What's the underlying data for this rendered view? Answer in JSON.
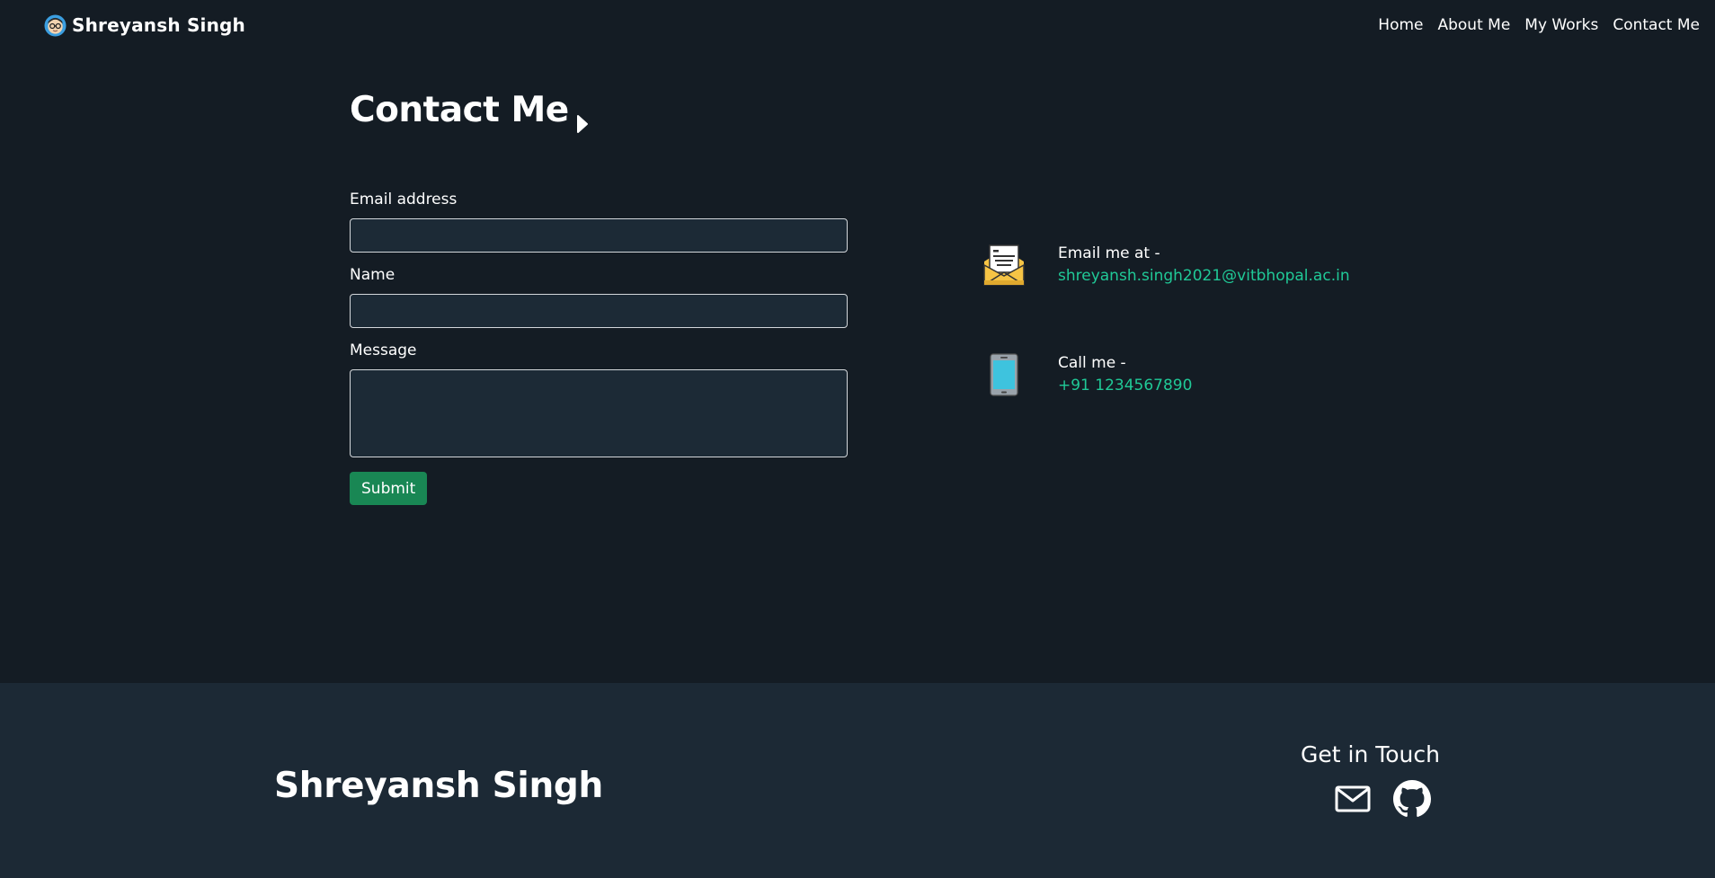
{
  "navbar": {
    "brand": "Shreyansh Singh",
    "links": [
      "Home",
      "About Me",
      "My Works",
      "Contact Me"
    ]
  },
  "contact": {
    "title": "Contact Me",
    "form": {
      "email_label": "Email address",
      "email_value": "",
      "name_label": "Name",
      "name_value": "",
      "message_label": "Message",
      "message_value": "",
      "submit_label": "Submit"
    },
    "info": {
      "email_label": "Email me at -",
      "email_value": "shreyansh.singh2021@vitbhopal.ac.in",
      "phone_label": "Call me -",
      "phone_value": "+91 1234567890"
    }
  },
  "footer": {
    "name": "Shreyansh Singh",
    "get_in_touch": "Get in Touch"
  },
  "colors": {
    "background": "#141c24",
    "footer_background": "#1c2935",
    "accent": "#20c997",
    "button": "#198754"
  },
  "icons": {
    "brand": "avatar-icon",
    "title": "caret-right-icon",
    "email_info": "envelope-letter-icon",
    "phone_info": "mobile-phone-icon",
    "footer_mail": "mail-icon",
    "footer_github": "github-icon"
  }
}
